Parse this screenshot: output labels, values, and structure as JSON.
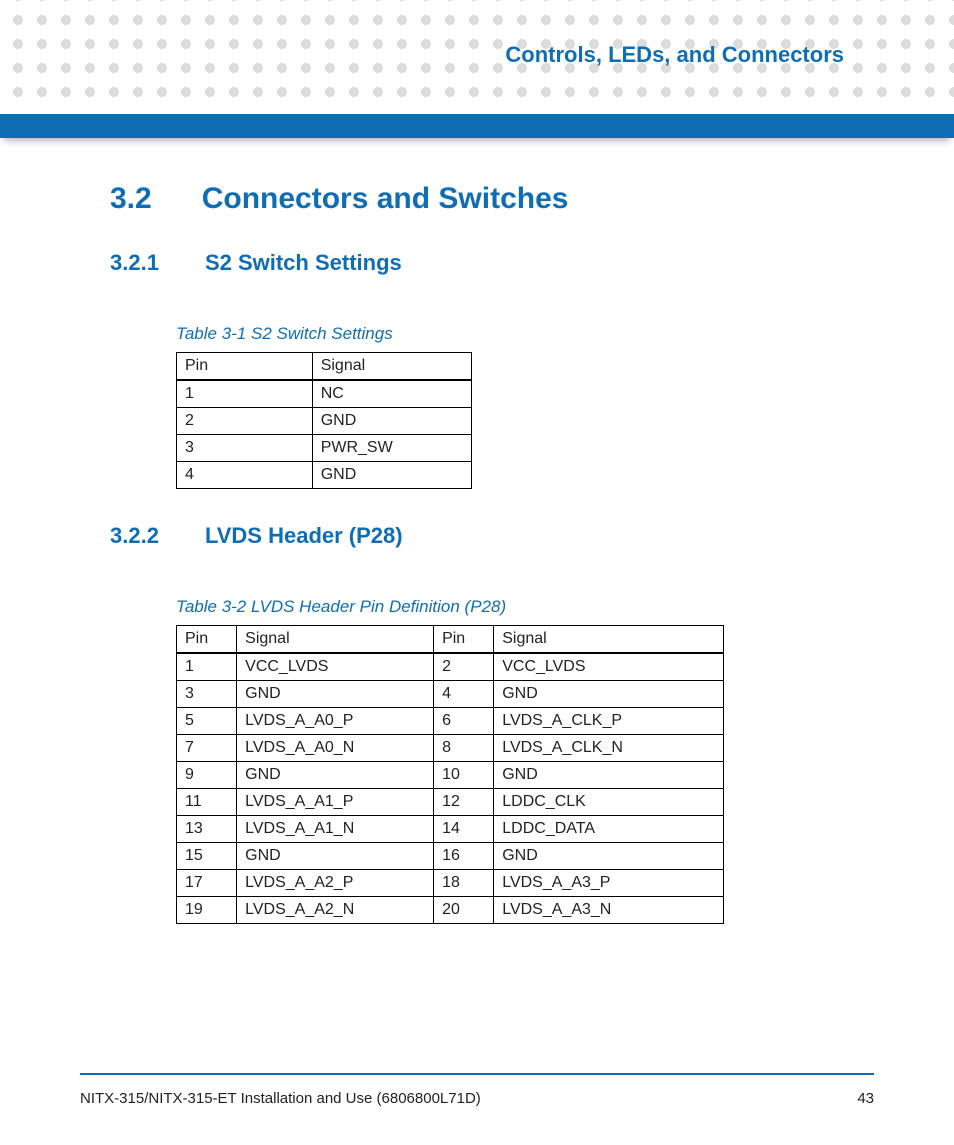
{
  "chapter_title": "Controls, LEDs, and Connectors",
  "section": {
    "num": "3.2",
    "title": "Connectors and Switches"
  },
  "sub1": {
    "num": "3.2.1",
    "title": "S2 Switch Settings",
    "caption": "Table 3-1 S2 Switch Settings",
    "headers": [
      "Pin",
      "Signal"
    ],
    "rows": [
      [
        "1",
        "NC"
      ],
      [
        "2",
        "GND"
      ],
      [
        "3",
        "PWR_SW"
      ],
      [
        "4",
        "GND"
      ]
    ]
  },
  "sub2": {
    "num": "3.2.2",
    "title": "LVDS Header (P28)",
    "caption": "Table 3-2 LVDS Header Pin Definition (P28)",
    "headers": [
      "Pin",
      "Signal",
      "Pin",
      "Signal"
    ],
    "rows": [
      [
        "1",
        "VCC_LVDS",
        "2",
        "VCC_LVDS"
      ],
      [
        "3",
        "GND",
        "4",
        "GND"
      ],
      [
        "5",
        "LVDS_A_A0_P",
        "6",
        "LVDS_A_CLK_P"
      ],
      [
        "7",
        "LVDS_A_A0_N",
        "8",
        "LVDS_A_CLK_N"
      ],
      [
        "9",
        "GND",
        "10",
        "GND"
      ],
      [
        "11",
        "LVDS_A_A1_P",
        "12",
        "LDDC_CLK"
      ],
      [
        "13",
        "LVDS_A_A1_N",
        "14",
        "LDDC_DATA"
      ],
      [
        "15",
        "GND",
        "16",
        "GND"
      ],
      [
        "17",
        "LVDS_A_A2_P",
        "18",
        "LVDS_A_A3_P"
      ],
      [
        "19",
        "LVDS_A_A2_N",
        "20",
        "LVDS_A_A3_N"
      ]
    ]
  },
  "footer": {
    "doc": "NITX-315/NITX-315-ET Installation and Use (6806800L71D)",
    "page": "43"
  }
}
